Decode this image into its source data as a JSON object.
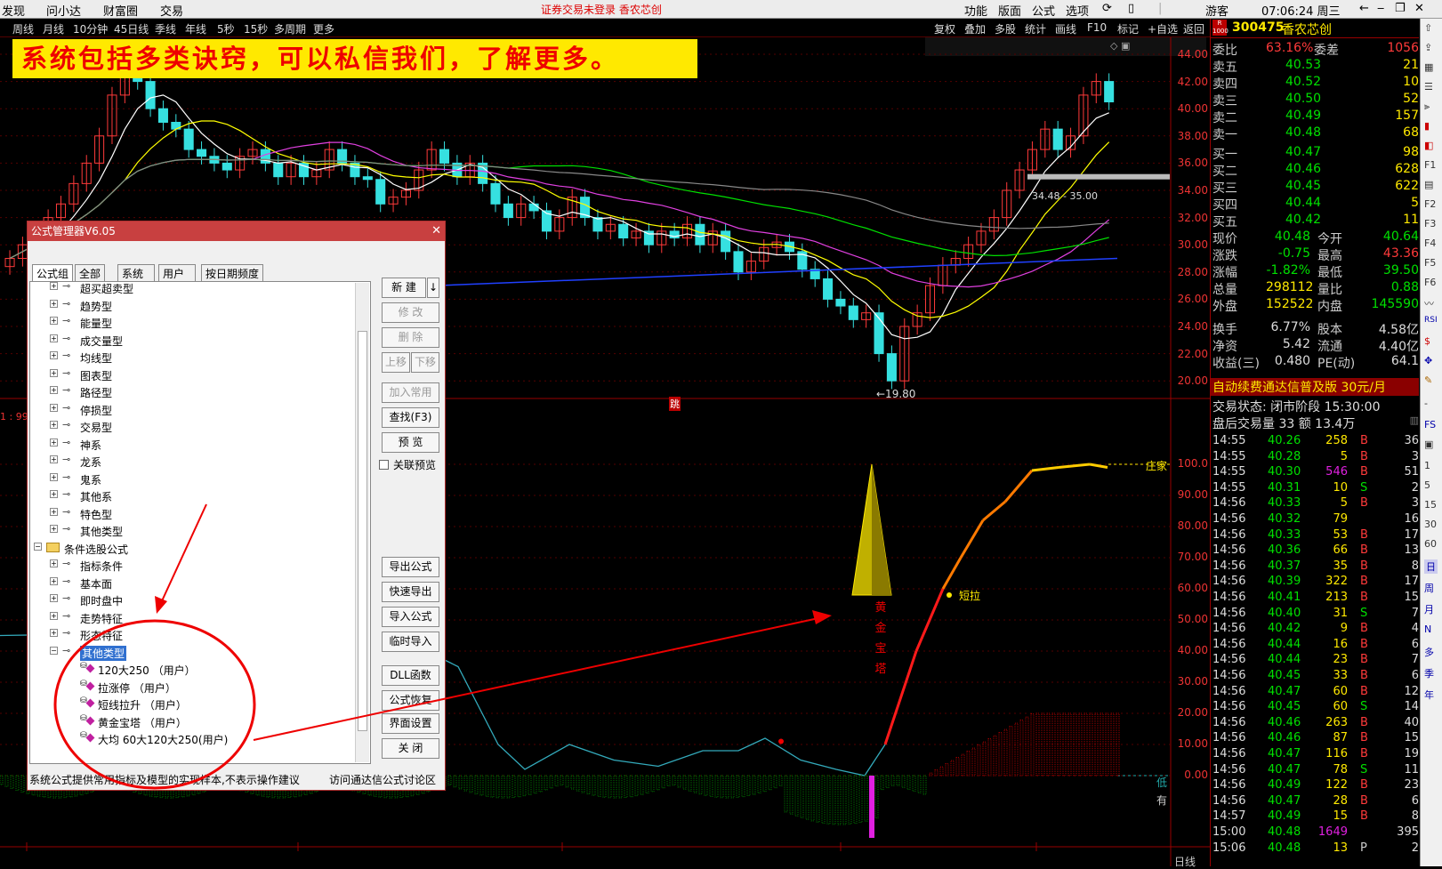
{
  "topbar": {
    "menu": [
      "发现",
      "问小达",
      "财富圈",
      "交易"
    ],
    "status": "证券交易未登录  香农芯创",
    "right_menu": [
      "功能",
      "版面",
      "公式",
      "选项"
    ],
    "user": "游客",
    "clock": "07:06:24 周三"
  },
  "chartbar": {
    "timeframes": [
      "周线",
      "月线",
      "10分钟",
      "45日线",
      "季线",
      "年线",
      "5秒",
      "15秒",
      "多周期",
      "更多"
    ],
    "tools": [
      "复权",
      "叠加",
      "多股",
      "统计",
      "画线",
      "F10",
      "标记",
      "+自选",
      "返回"
    ]
  },
  "banner": "系统包括多类诀窍，可以私信我们，了解更多。",
  "price_axis": [
    "44.00",
    "42.00",
    "40.00",
    "38.00",
    "36.00",
    "34.00",
    "32.00",
    "30.00",
    "28.00",
    "26.00",
    "24.00",
    "22.00",
    "20.00"
  ],
  "ind_axis": [
    "100.0",
    "90.00",
    "80.00",
    "70.00",
    "60.00",
    "50.00",
    "40.00",
    "30.00",
    "20.00",
    "10.00",
    "0.00"
  ],
  "annotations": {
    "low": "←19.80",
    "range": "34.48 - 35.00",
    "tower": [
      "黄",
      "金",
      "宝",
      "塔"
    ],
    "short_pull": "短拉",
    "zhuang": "庄家",
    "low_label": "低",
    "you": "有",
    "date_label": "日线",
    "tick_jump": "跳",
    "left_marker": "1 : 99"
  },
  "stock": {
    "code": "300475",
    "name": "香农芯创",
    "weibi_label": "委比",
    "weibi": "63.16%",
    "weicha_label": "委差",
    "weicha": "1056"
  },
  "order_book": [
    {
      "label": "卖五",
      "price": "40.53",
      "vol": "21"
    },
    {
      "label": "卖四",
      "price": "40.52",
      "vol": "10"
    },
    {
      "label": "卖三",
      "price": "40.50",
      "vol": "52"
    },
    {
      "label": "卖二",
      "price": "40.49",
      "vol": "157"
    },
    {
      "label": "卖一",
      "price": "40.48",
      "vol": "68"
    },
    {
      "label": "买一",
      "price": "40.47",
      "vol": "98"
    },
    {
      "label": "买二",
      "price": "40.46",
      "vol": "628"
    },
    {
      "label": "买三",
      "price": "40.45",
      "vol": "622"
    },
    {
      "label": "买四",
      "price": "40.44",
      "vol": "5"
    },
    {
      "label": "买五",
      "price": "40.42",
      "vol": "11"
    }
  ],
  "quote": [
    {
      "l1": "现价",
      "v1": "40.48",
      "l2": "今开",
      "v2": "40.64"
    },
    {
      "l1": "涨跌",
      "v1": "-0.75",
      "l2": "最高",
      "v2": "43.36"
    },
    {
      "l1": "涨幅",
      "v1": "-1.82%",
      "l2": "最低",
      "v2": "39.50"
    },
    {
      "l1": "总量",
      "v1": "298112",
      "l2": "量比",
      "v2": "0.88"
    },
    {
      "l1": "外盘",
      "v1": "152522",
      "l2": "内盘",
      "v2": "145590"
    },
    {
      "l1": "换手",
      "v1": "6.77%",
      "l2": "股本",
      "v2": "4.58亿"
    },
    {
      "l1": "净资",
      "v1": "5.42",
      "l2": "流通",
      "v2": "4.40亿"
    },
    {
      "l1": "收益(三)",
      "v1": "0.480",
      "l2": "PE(动)",
      "v2": "64.1"
    }
  ],
  "promo": "自动续费通达信普及版 30元/月",
  "trade_state": "交易状态: 闭市阶段 15:30:00",
  "after_hours": "盘后交易量 33 额 13.4万",
  "ticks": [
    [
      "14:55",
      "40.26",
      "258",
      "B",
      "36"
    ],
    [
      "14:55",
      "40.28",
      "5",
      "B",
      "3"
    ],
    [
      "14:55",
      "40.30",
      "546",
      "B",
      "51"
    ],
    [
      "14:55",
      "40.31",
      "10",
      "S",
      "2"
    ],
    [
      "14:56",
      "40.33",
      "5",
      "B",
      "3"
    ],
    [
      "14:56",
      "40.32",
      "79",
      "",
      "16"
    ],
    [
      "14:56",
      "40.33",
      "53",
      "B",
      "17"
    ],
    [
      "14:56",
      "40.36",
      "66",
      "B",
      "13"
    ],
    [
      "14:56",
      "40.37",
      "35",
      "B",
      "8"
    ],
    [
      "14:56",
      "40.39",
      "322",
      "B",
      "17"
    ],
    [
      "14:56",
      "40.41",
      "213",
      "B",
      "15"
    ],
    [
      "14:56",
      "40.40",
      "31",
      "S",
      "7"
    ],
    [
      "14:56",
      "40.42",
      "9",
      "B",
      "4"
    ],
    [
      "14:56",
      "40.44",
      "16",
      "B",
      "6"
    ],
    [
      "14:56",
      "40.44",
      "23",
      "B",
      "7"
    ],
    [
      "14:56",
      "40.45",
      "33",
      "B",
      "6"
    ],
    [
      "14:56",
      "40.47",
      "60",
      "B",
      "12"
    ],
    [
      "14:56",
      "40.45",
      "60",
      "S",
      "14"
    ],
    [
      "14:56",
      "40.46",
      "263",
      "B",
      "40"
    ],
    [
      "14:56",
      "40.46",
      "87",
      "B",
      "15"
    ],
    [
      "14:56",
      "40.47",
      "116",
      "B",
      "19"
    ],
    [
      "14:56",
      "40.47",
      "78",
      "S",
      "11"
    ],
    [
      "14:56",
      "40.49",
      "122",
      "B",
      "23"
    ],
    [
      "14:56",
      "40.47",
      "28",
      "B",
      "6"
    ],
    [
      "14:57",
      "40.49",
      "15",
      "B",
      "8"
    ],
    [
      "15:00",
      "40.48",
      "1649",
      "",
      "395"
    ],
    [
      "15:06",
      "40.48",
      "13",
      "P",
      "2"
    ]
  ],
  "side_icons": [
    "up-arrow-icon",
    "down-arrow-icon",
    "grid-icon",
    "list-icon",
    "chart-icon",
    "bar-icon",
    "K线",
    "分时",
    "F10",
    "RSI",
    "日",
    "周",
    "月",
    "多",
    "季",
    "年"
  ],
  "side_labels": [
    "RSI",
    "日",
    "周",
    "月",
    "N",
    "多",
    "季",
    "年",
    "5",
    "15",
    "30",
    "60"
  ],
  "dialog": {
    "title": "公式管理器V6.05",
    "tabs": [
      "公式组",
      "全部",
      "系统",
      "用户",
      "按日期频度"
    ],
    "tree": [
      {
        "label": "超买超卖型",
        "lvl": 2
      },
      {
        "label": "趋势型",
        "lvl": 2
      },
      {
        "label": "能量型",
        "lvl": 2
      },
      {
        "label": "成交量型",
        "lvl": 2
      },
      {
        "label": "均线型",
        "lvl": 2
      },
      {
        "label": "图表型",
        "lvl": 2
      },
      {
        "label": "路径型",
        "lvl": 2
      },
      {
        "label": "停损型",
        "lvl": 2
      },
      {
        "label": "交易型",
        "lvl": 2
      },
      {
        "label": "神系",
        "lvl": 2
      },
      {
        "label": "龙系",
        "lvl": 2
      },
      {
        "label": "鬼系",
        "lvl": 2
      },
      {
        "label": "其他系",
        "lvl": 2
      },
      {
        "label": "特色型",
        "lvl": 2
      },
      {
        "label": "其他类型",
        "lvl": 2
      },
      {
        "label": "条件选股公式",
        "lvl": 1
      },
      {
        "label": "指标条件",
        "lvl": 2
      },
      {
        "label": "基本面",
        "lvl": 2
      },
      {
        "label": "即时盘中",
        "lvl": 2
      },
      {
        "label": "走势特征",
        "lvl": 2
      },
      {
        "label": "形态特征",
        "lvl": 2
      },
      {
        "label": "其他类型",
        "lvl": 2
      },
      {
        "label": "120大250 （用户）",
        "lvl": 3
      },
      {
        "label": "拉涨停 （用户）",
        "lvl": 3
      },
      {
        "label": "短线拉升 （用户）",
        "lvl": 3
      },
      {
        "label": "黄金宝塔 （用户）",
        "lvl": 3
      },
      {
        "label": "大均  60大120大250(用户)",
        "lvl": 3
      }
    ],
    "buttons": {
      "new": "新 建",
      "modify": "修 改",
      "delete": "删 除",
      "up": "上移",
      "down": "下移",
      "add_common": "加入常用",
      "find": "查找(F3)",
      "preview": "预 览",
      "link_preview": "关联预览",
      "export": "导出公式",
      "quick_export": "快速导出",
      "import": "导入公式",
      "temp_import": "临时导入",
      "dll": "DLL函数",
      "restore": "公式恢复",
      "ui_settings": "界面设置",
      "close": "关 闭"
    },
    "footer_left": "系统公式提供常用指标及模型的实现样本,不表示操作建议",
    "footer_right": "访问通达信公式讨论区"
  },
  "colors": {
    "up": "#ff3a3a",
    "down": "#36e0e0",
    "ma5": "#ffffff",
    "ma10": "#ffff00",
    "ma20": "#e040e0",
    "ma60": "#00e000",
    "ma120": "#888888",
    "ma250": "#2040ff",
    "yellow": "#ffe900"
  }
}
